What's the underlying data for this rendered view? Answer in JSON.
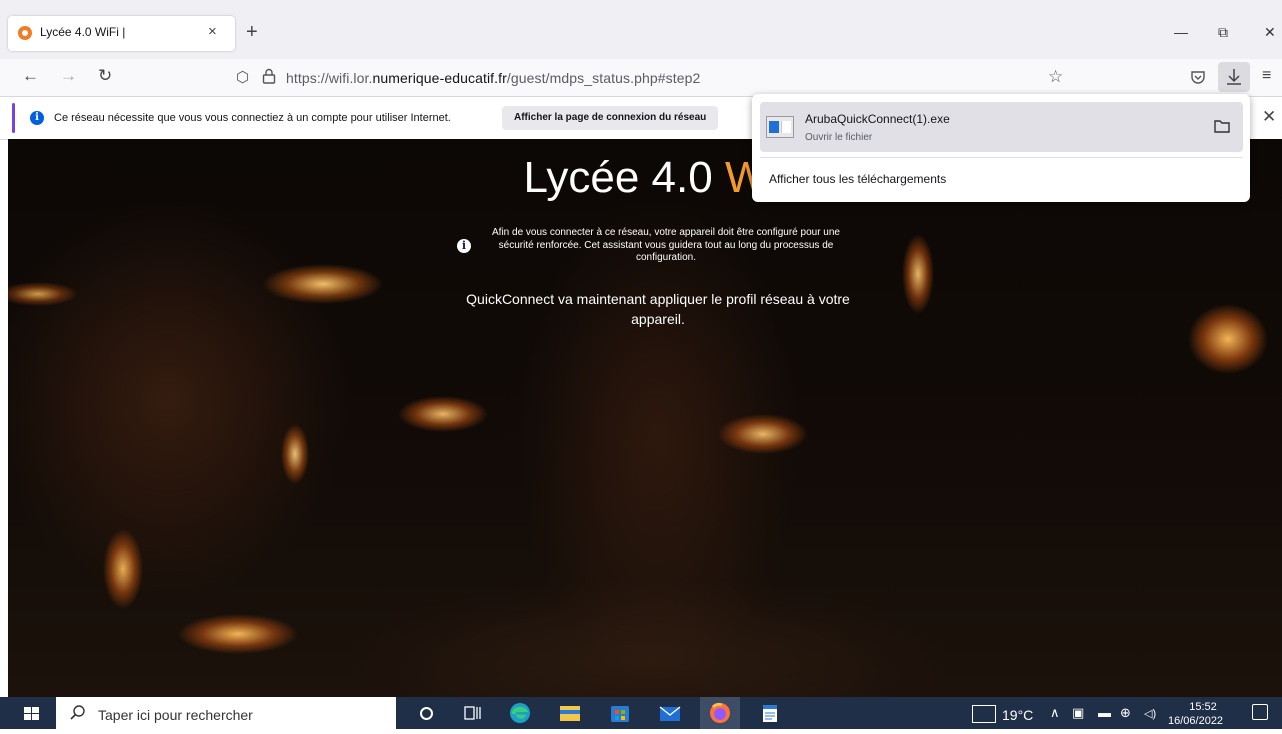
{
  "browser": {
    "tab_title": "Lycée 4.0 WiFi |",
    "tab_close": "×",
    "new_tab": "+",
    "window_controls": {
      "minimize": "—",
      "restore": "⧉",
      "close": "✕"
    },
    "url": {
      "prefix": "https://wifi.lor.",
      "domain": "numerique-educatif.fr",
      "path": "/guest/mdps_status.php#step2"
    }
  },
  "notification": {
    "text": "Ce réseau nécessite que vous vous connectiez à un compte pour utiliser Internet.",
    "button": "Afficher la page de connexion du réseau",
    "close": "✕"
  },
  "page": {
    "title_main": "Lycée 4.0 ",
    "title_accent": "W",
    "intro": "Afin de vous connecter à ce réseau, votre appareil doit être configuré pour une sécurité renforcée. Cet assistant vous guidera tout au long du processus de configuration.",
    "status": "QuickConnect va maintenant appliquer le profil réseau à votre appareil."
  },
  "downloads": {
    "file_name": "ArubaQuickConnect(1).exe",
    "file_status": "Ouvrir le fichier",
    "show_all": "Afficher tous les téléchargements"
  },
  "taskbar": {
    "search_placeholder": "Taper ici pour rechercher",
    "temperature": "19°C",
    "time": "15:52",
    "date": "16/06/2022"
  },
  "colors": {
    "accent": "#f39a2b",
    "taskbar": "#1f2f47",
    "info_blue": "#0060df"
  }
}
